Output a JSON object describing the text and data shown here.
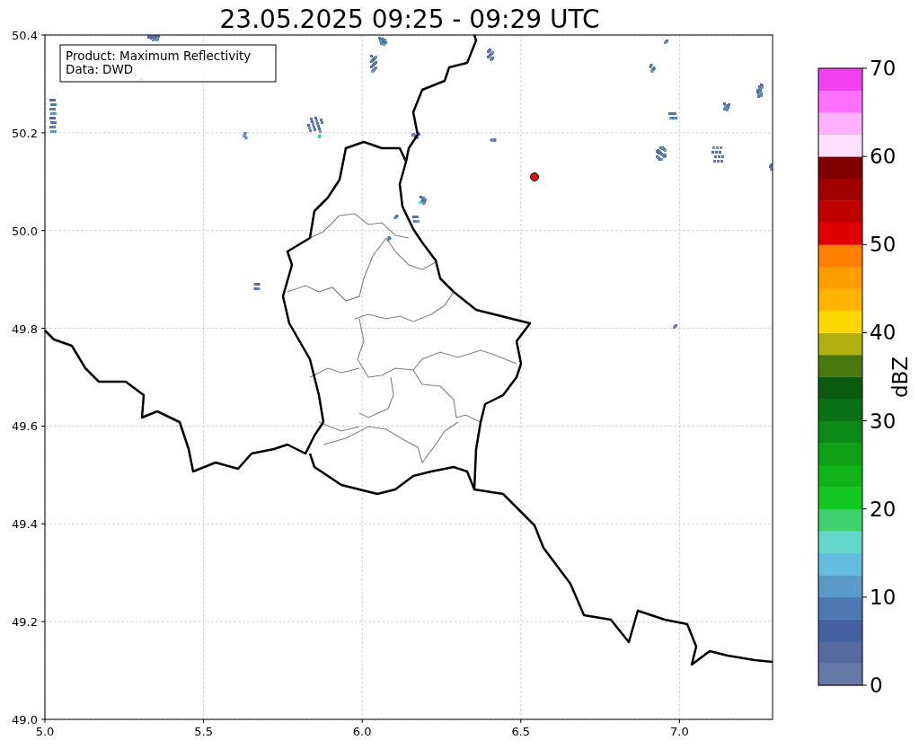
{
  "title": "23.05.2025 09:25 - 09:29 UTC",
  "map": {
    "info_lines": [
      "Product: Maximum Reflectivity",
      "Data: DWD"
    ],
    "x_ticks": [
      "5.0",
      "5.5",
      "6.0",
      "6.5",
      "7.0"
    ],
    "y_ticks": [
      "50.4",
      "50.2",
      "50.0",
      "49.8",
      "49.6",
      "49.4",
      "49.2",
      "49.0"
    ]
  },
  "colorbar": {
    "label": "dBZ",
    "ticks": [
      "70",
      "60",
      "50",
      "40",
      "30",
      "20",
      "10",
      "0"
    ],
    "bands": [
      {
        "color": "#6677a8"
      },
      {
        "color": "#5568a0"
      },
      {
        "color": "#4560a0"
      },
      {
        "color": "#4a78b0"
      },
      {
        "color": "#5a9ac8"
      },
      {
        "color": "#64bee0"
      },
      {
        "color": "#64d8c8"
      },
      {
        "color": "#40d070"
      },
      {
        "color": "#10c820"
      },
      {
        "color": "#10b418"
      },
      {
        "color": "#10a018"
      },
      {
        "color": "#0a8a14"
      },
      {
        "color": "#0a7014"
      },
      {
        "color": "#0a5a10"
      },
      {
        "color": "#4a7810"
      },
      {
        "color": "#b0b010"
      },
      {
        "color": "#ffd800"
      },
      {
        "color": "#ffb400"
      },
      {
        "color": "#ff9c00"
      },
      {
        "color": "#ff8000"
      },
      {
        "color": "#e00000"
      },
      {
        "color": "#c00000"
      },
      {
        "color": "#a00000"
      },
      {
        "color": "#800000"
      },
      {
        "color": "#ffe0ff"
      },
      {
        "color": "#ffb0ff"
      },
      {
        "color": "#ff70ff"
      },
      {
        "color": "#f040f0"
      }
    ]
  }
}
